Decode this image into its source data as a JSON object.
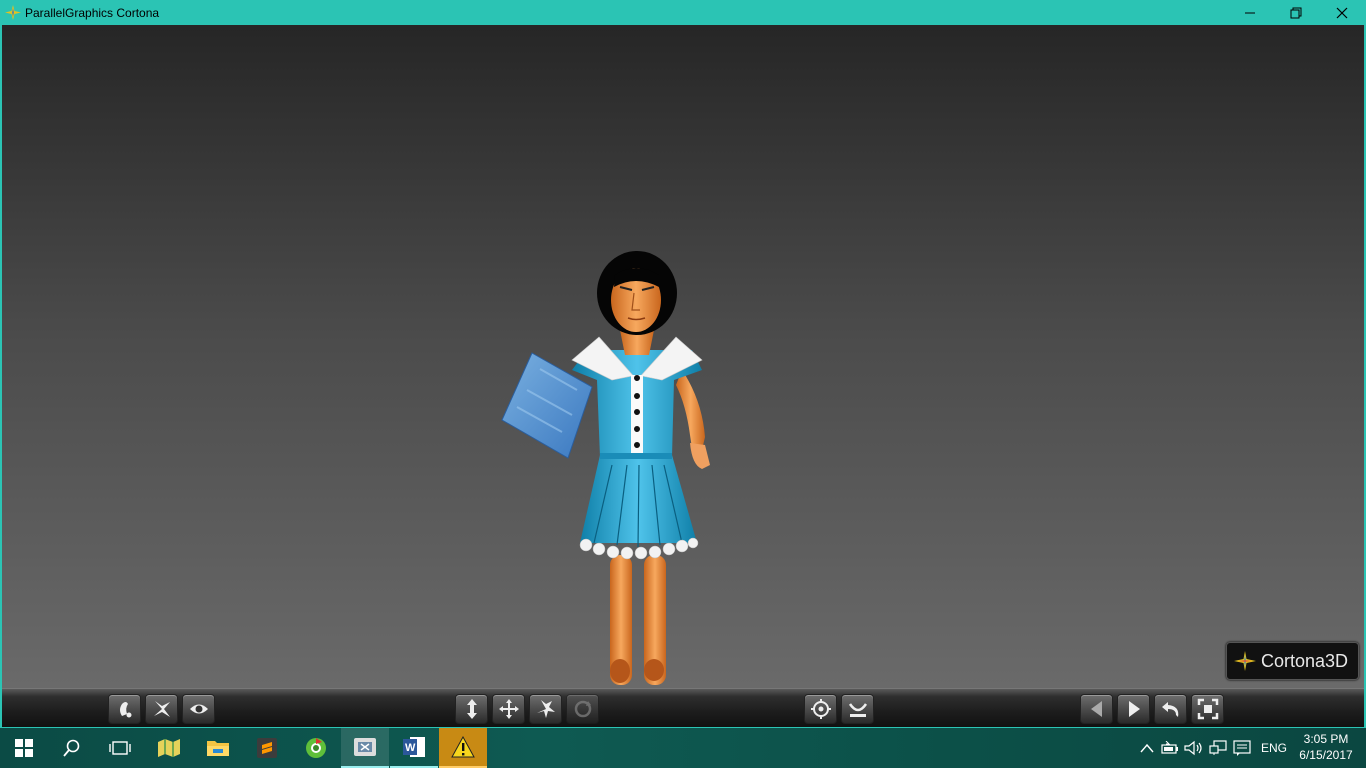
{
  "window": {
    "title": "ParallelGraphics Cortona",
    "controls": [
      "minimize",
      "restore",
      "close"
    ]
  },
  "viewport": {
    "content": "3D avatar of a woman in a blue dress holding a blue textured card",
    "brand_logo": "Cortona3D"
  },
  "toolbar": {
    "left_group": [
      {
        "name": "walk-mode-button",
        "icon": "footprint-icon"
      },
      {
        "name": "fly-mode-button",
        "icon": "fly-icon"
      },
      {
        "name": "study-mode-button",
        "icon": "eye-icon"
      }
    ],
    "center_group": [
      {
        "name": "plan-button",
        "icon": "plan-arrows-icon"
      },
      {
        "name": "pan-button",
        "icon": "pan-arrows-icon"
      },
      {
        "name": "turn-button",
        "icon": "turn-icon"
      },
      {
        "name": "roll-button",
        "icon": "roll-icon",
        "disabled": true
      }
    ],
    "right_center_group": [
      {
        "name": "goto-button",
        "icon": "target-icon"
      },
      {
        "name": "align-button",
        "icon": "align-icon"
      }
    ],
    "right_group": [
      {
        "name": "previous-viewpoint-button",
        "icon": "triangle-left-icon"
      },
      {
        "name": "next-viewpoint-button",
        "icon": "triangle-right-icon"
      },
      {
        "name": "restore-button",
        "icon": "undo-icon"
      },
      {
        "name": "fit-button",
        "icon": "fit-icon"
      }
    ]
  },
  "taskbar": {
    "items": [
      {
        "name": "start-button",
        "icon": "windows-icon"
      },
      {
        "name": "search-button",
        "icon": "search-icon"
      },
      {
        "name": "task-view-button",
        "icon": "task-view-icon"
      },
      {
        "name": "app-maps",
        "icon": "maps-icon"
      },
      {
        "name": "app-file-explorer",
        "icon": "folder-icon"
      },
      {
        "name": "app-sublime",
        "icon": "sublime-icon"
      },
      {
        "name": "app-browser",
        "icon": "browser-icon"
      },
      {
        "name": "app-cortona",
        "icon": "cortona-icon"
      },
      {
        "name": "app-word",
        "icon": "word-icon"
      },
      {
        "name": "app-warning",
        "icon": "warning-icon"
      }
    ],
    "tray": {
      "language": "ENG",
      "time": "3:05 PM",
      "date": "6/15/2017"
    }
  }
}
